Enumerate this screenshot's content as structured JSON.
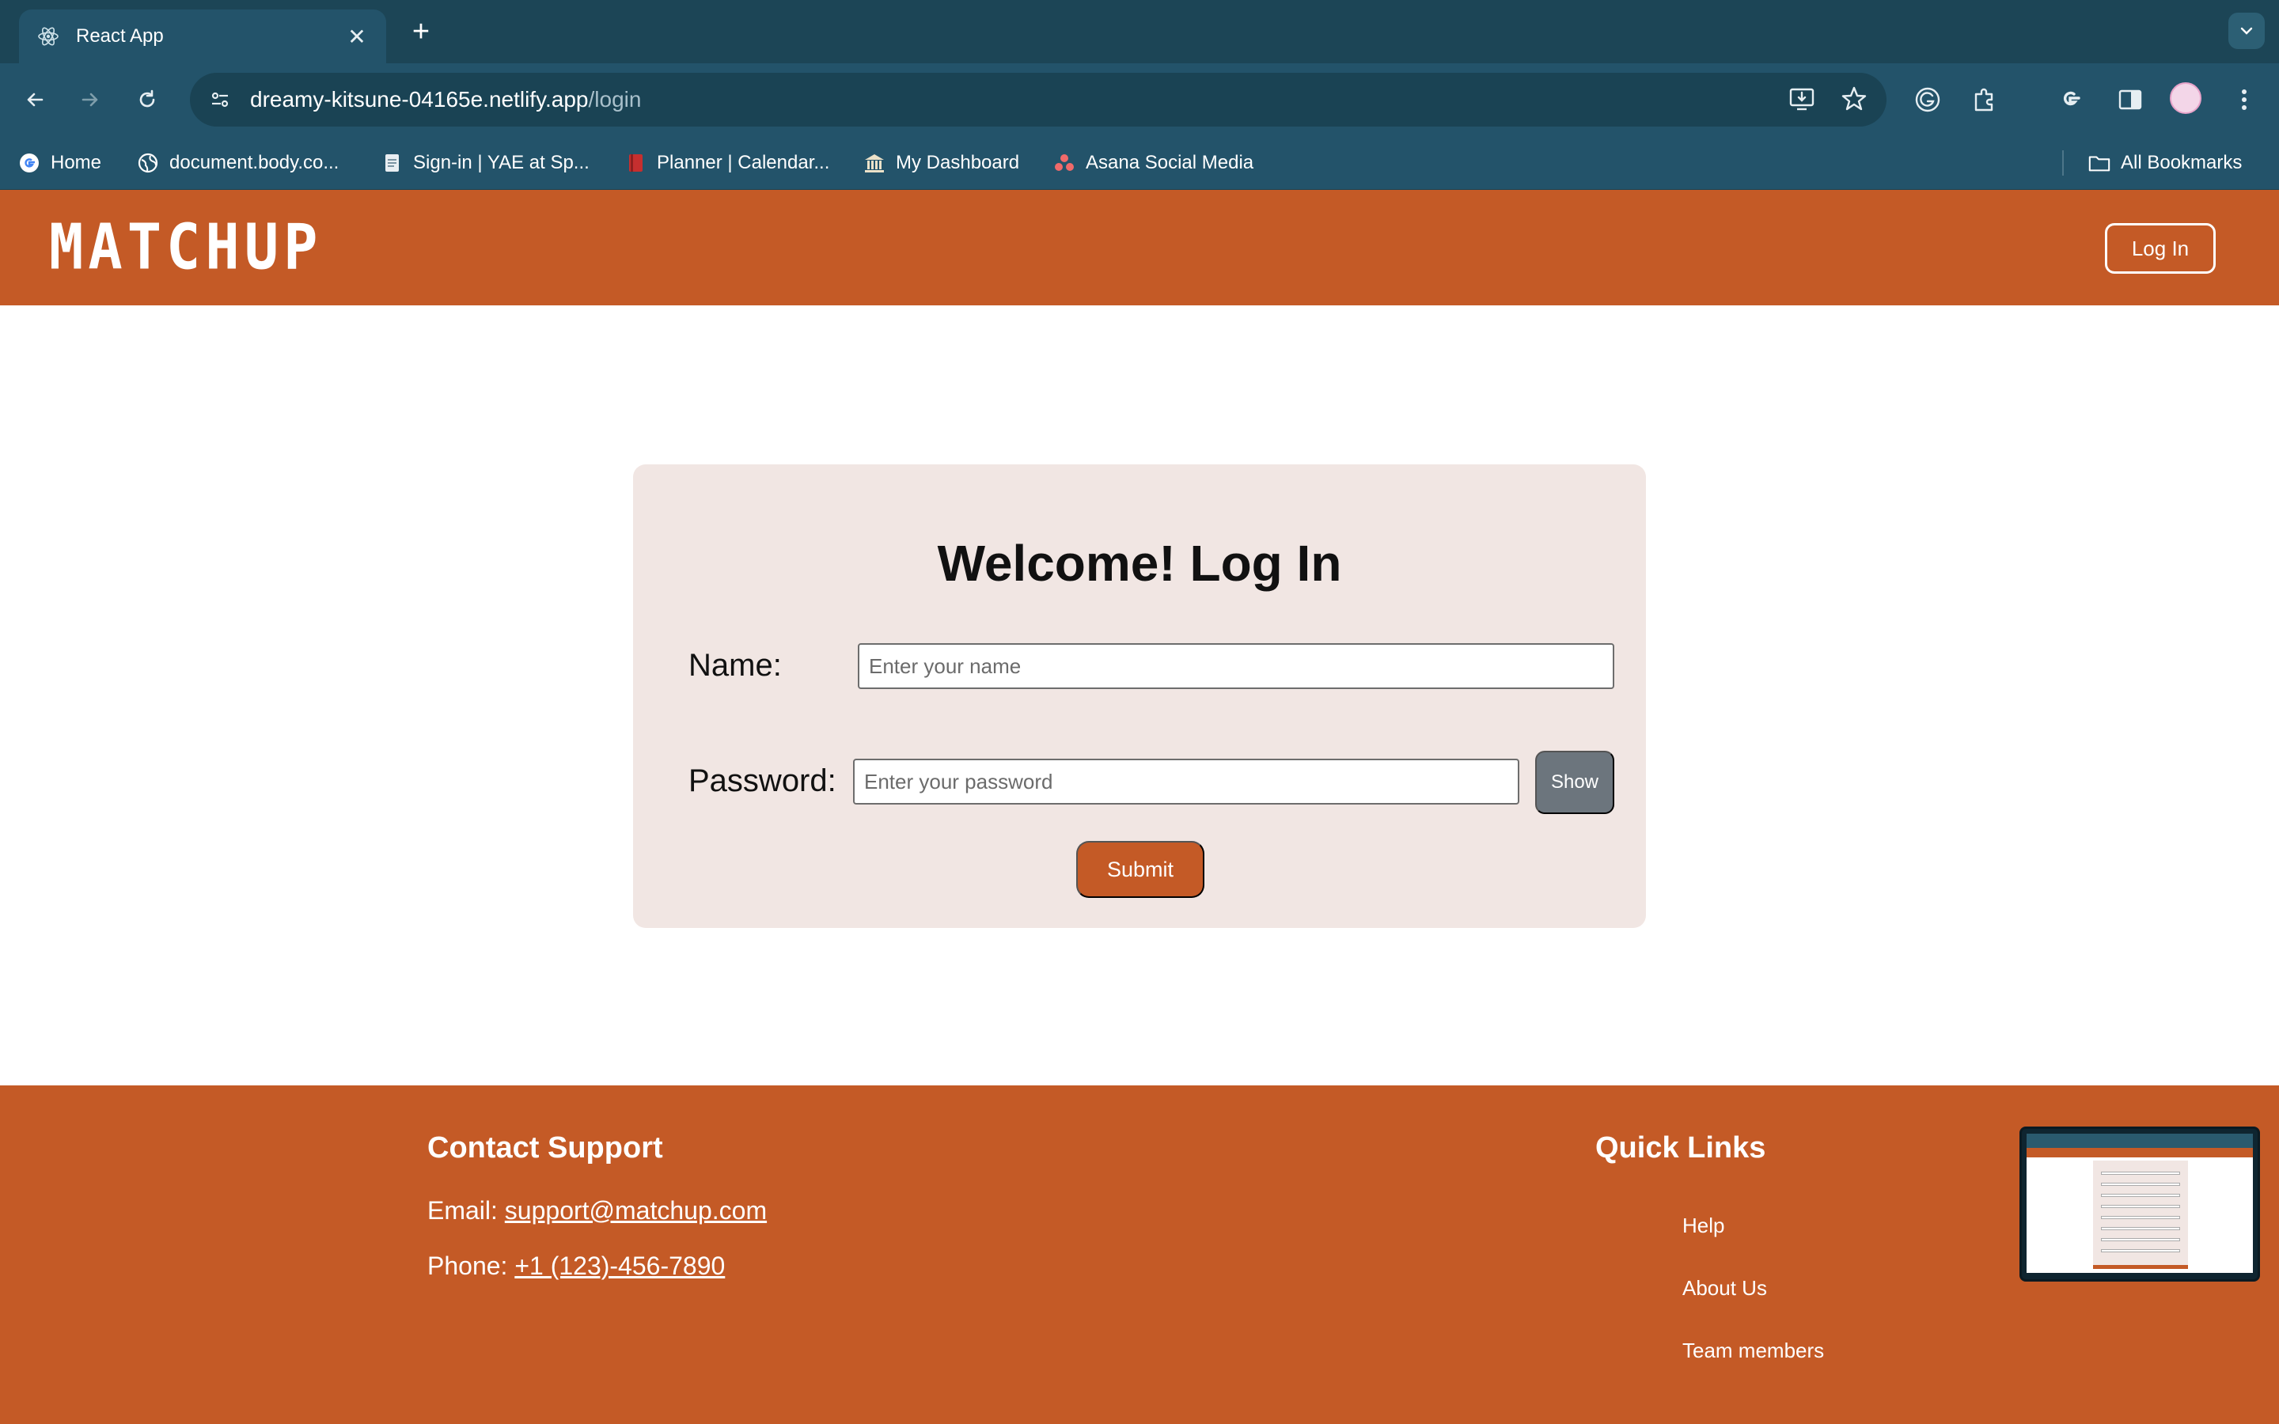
{
  "browser": {
    "tab_title": "React App",
    "url_host": "dreamy-kitsune-04165e.netlify.app",
    "url_path": "/login",
    "bookmarks": [
      {
        "label": "Home",
        "icon": "google-icon"
      },
      {
        "label": "document.body.co...",
        "icon": "globe-icon"
      },
      {
        "label": "Sign-in | YAE at Sp...",
        "icon": "doc-icon"
      },
      {
        "label": "Planner | Calendar...",
        "icon": "book-icon"
      },
      {
        "label": "My Dashboard",
        "icon": "bank-icon"
      },
      {
        "label": "Asana Social Media",
        "icon": "asana-icon"
      }
    ],
    "all_bookmarks": "All Bookmarks"
  },
  "header": {
    "logo": "MATCHUP",
    "login_label": "Log In"
  },
  "login": {
    "title": "Welcome! Log In",
    "name_label": "Name:",
    "name_placeholder": "Enter your name",
    "password_label": "Password:",
    "password_placeholder": "Enter your password",
    "show_label": "Show",
    "submit_label": "Submit"
  },
  "footer": {
    "contact_title": "Contact Support",
    "email_prefix": "Email: ",
    "email": "support@matchup.com",
    "phone_prefix": "Phone: ",
    "phone": "+1 (123)-456-7890",
    "quick_links_title": "Quick Links",
    "links": [
      "Help",
      "About Us",
      "Team members"
    ]
  },
  "colors": {
    "brand": "#c45a26",
    "card": "#f1e6e3",
    "chrome": "#23536a"
  }
}
